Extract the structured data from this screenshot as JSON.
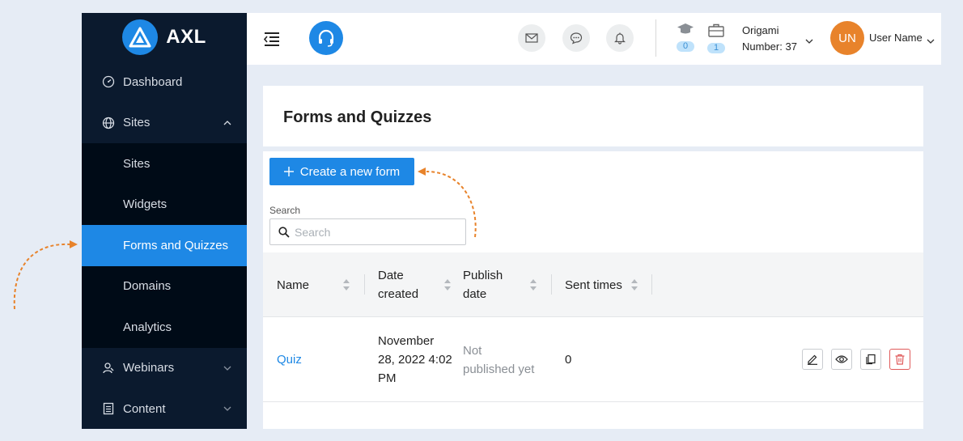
{
  "app": {
    "brand": "AXL",
    "brand_color": "#1e88e5",
    "accent": "#e8832b"
  },
  "sidebar": {
    "items": [
      {
        "label": "Dashboard",
        "icon": "dashboard-icon"
      },
      {
        "label": "Sites",
        "icon": "globe-icon",
        "expanded": true,
        "children": [
          {
            "label": "Sites"
          },
          {
            "label": "Widgets"
          },
          {
            "label": "Forms and Quizzes",
            "active": true
          },
          {
            "label": "Domains"
          },
          {
            "label": "Analytics"
          }
        ]
      },
      {
        "label": "Webinars",
        "icon": "webinar-icon"
      },
      {
        "label": "Content",
        "icon": "document-icon"
      }
    ]
  },
  "header": {
    "courses_count": "0",
    "jobs_count": "1",
    "org_name": "Origami",
    "org_number": "Number: 37",
    "avatar_initials": "UN",
    "user_name": "User Name"
  },
  "page": {
    "title": "Forms and Quizzes",
    "create_button": "Create a new form",
    "search_label": "Search",
    "search_placeholder": "Search"
  },
  "table": {
    "columns": [
      {
        "label": "Name"
      },
      {
        "line1": "Date",
        "line2": "created"
      },
      {
        "line1": "Publish",
        "line2": "date"
      },
      {
        "label": "Sent times"
      }
    ],
    "rows": [
      {
        "name": "Quiz",
        "date_line1": "November",
        "date_line2": "28, 2022 4:02",
        "date_line3": "PM",
        "publish_line1": "Not",
        "publish_line2": "published yet",
        "sent_times": "0"
      }
    ]
  }
}
